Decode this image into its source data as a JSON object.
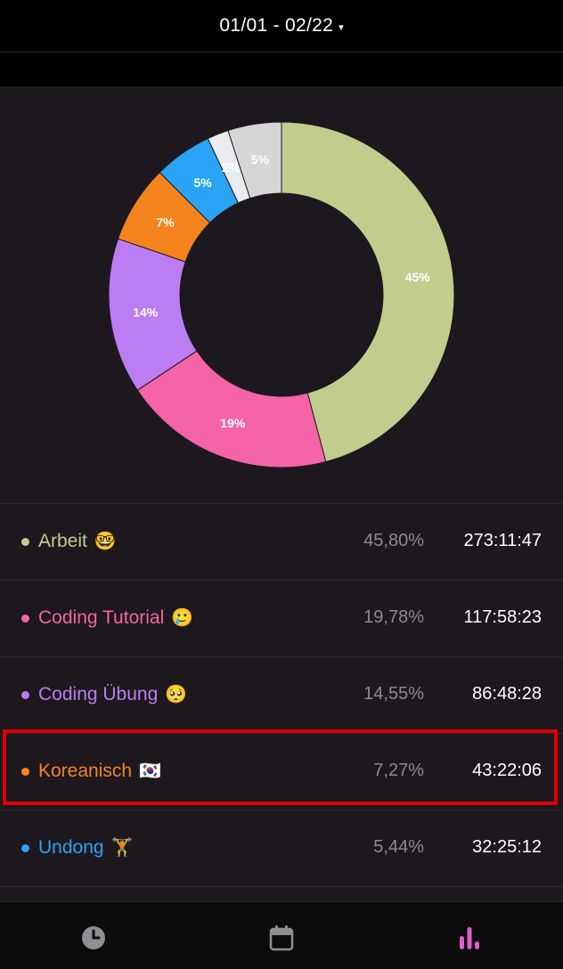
{
  "header": {
    "date_range": "01/01 - 02/22",
    "caret": "▾"
  },
  "chart_data": {
    "type": "pie",
    "title": "",
    "categories": [
      "Arbeit",
      "Coding Tutorial",
      "Coding Übung",
      "Koreanisch",
      "Undong",
      "",
      ""
    ],
    "values": [
      45.8,
      19.78,
      14.55,
      7.27,
      5.44,
      2,
      5
    ],
    "slice_labels": [
      "45%",
      "19%",
      "14%",
      "7%",
      "5%",
      "2%",
      "5%"
    ],
    "colors": [
      "#c1cd8c",
      "#f564a6",
      "#bc7df3",
      "#f5841f",
      "#2aa4f4",
      "#e9ecef",
      "#d6d6d6"
    ],
    "donut": true
  },
  "list": [
    {
      "name": "Arbeit",
      "emoji": "🤓",
      "percent": "45,80%",
      "time": "273:11:47",
      "color": "#c1cd8c"
    },
    {
      "name": "Coding Tutorial",
      "emoji": "🥲",
      "percent": "19,78%",
      "time": "117:58:23",
      "color": "#f564a6"
    },
    {
      "name": "Coding Übung",
      "emoji": "🥺",
      "percent": "14,55%",
      "time": "86:48:28",
      "color": "#bc7df3"
    },
    {
      "name": "Koreanisch",
      "emoji": "🇰🇷",
      "percent": "7,27%",
      "time": "43:22:06",
      "color": "#f5841f"
    },
    {
      "name": "Undong",
      "emoji": "🏋",
      "percent": "5,44%",
      "time": "32:25:12",
      "color": "#2aa4f4"
    }
  ],
  "tabs": [
    {
      "name": "clock-icon",
      "active": false
    },
    {
      "name": "calendar-icon",
      "active": false
    },
    {
      "name": "bar-chart-icon",
      "active": true
    }
  ],
  "colors": {
    "accent": "#e05fc8",
    "tab_inactive": "#8e8e93",
    "highlight": "#e10000"
  }
}
